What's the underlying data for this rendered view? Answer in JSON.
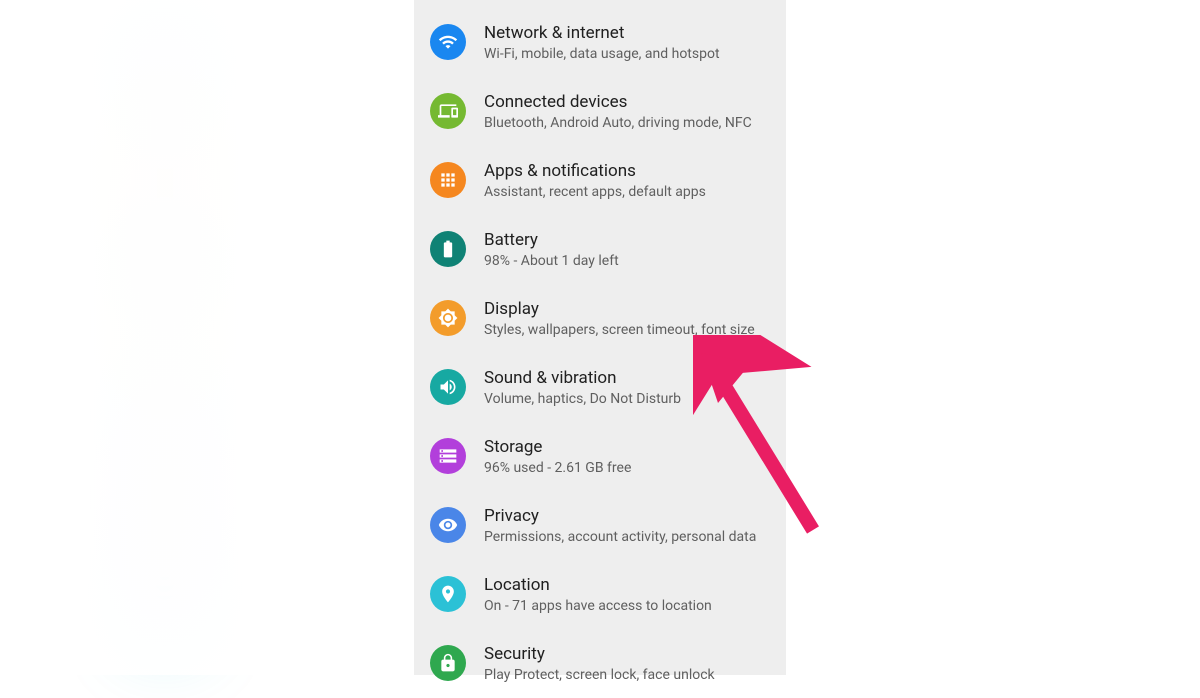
{
  "settings": {
    "items": [
      {
        "title": "Network & internet",
        "subtitle": "Wi-Fi, mobile, data usage, and hotspot",
        "color": "#1a87f0"
      },
      {
        "title": "Connected devices",
        "subtitle": "Bluetooth, Android Auto, driving mode, NFC",
        "color": "#75b931"
      },
      {
        "title": "Apps & notifications",
        "subtitle": "Assistant, recent apps, default apps",
        "color": "#f5871f"
      },
      {
        "title": "Battery",
        "subtitle": "98% - About 1 day left",
        "color": "#0f8275"
      },
      {
        "title": "Display",
        "subtitle": "Styles, wallpapers, screen timeout, font size",
        "color": "#f39c2b"
      },
      {
        "title": "Sound & vibration",
        "subtitle": "Volume, haptics, Do Not Disturb",
        "color": "#17a9a2"
      },
      {
        "title": "Storage",
        "subtitle": "96% used - 2.61 GB free",
        "color": "#b23fdb"
      },
      {
        "title": "Privacy",
        "subtitle": "Permissions, account activity, personal data",
        "color": "#4a86e8"
      },
      {
        "title": "Location",
        "subtitle": "On - 71 apps have access to location",
        "color": "#2bc1d6"
      },
      {
        "title": "Security",
        "subtitle": "Play Protect, screen lock, face unlock",
        "color": "#2fa84f"
      }
    ]
  },
  "annotation": {
    "arrow_points_to": "Display",
    "arrow_color": "#e91e63"
  }
}
